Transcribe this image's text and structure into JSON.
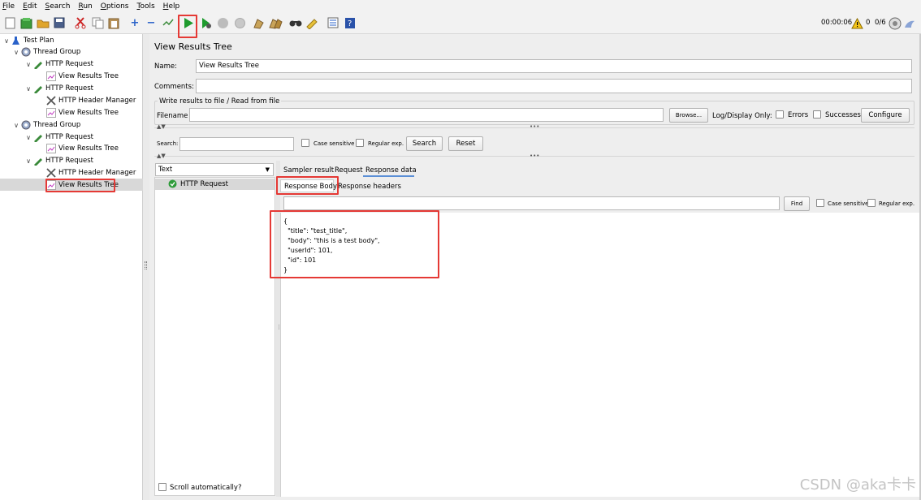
{
  "menu": [
    "File",
    "Edit",
    "Search",
    "Run",
    "Options",
    "Tools",
    "Help"
  ],
  "toolbar": {
    "icons": [
      "new-icon",
      "templates-icon",
      "open-icon",
      "save-icon",
      "cut-icon",
      "copy-icon",
      "paste-icon",
      "expand-icon",
      "collapse-icon",
      "toggle-icon",
      "start-icon",
      "start-no-pauses-icon",
      "stop-icon",
      "shutdown-icon",
      "clear-icon",
      "clear-all-icon",
      "search-icon",
      "reset-search-icon",
      "function-helper-icon",
      "help-icon"
    ],
    "timer": "00:00:06",
    "warnings": "0",
    "threads": "0/6"
  },
  "tree": [
    {
      "label": "Test Plan",
      "icon": "flask-icon"
    },
    {
      "label": "Thread Group",
      "icon": "gear-icon"
    },
    {
      "label": "HTTP Request",
      "icon": "pipette-icon"
    },
    {
      "label": "View Results Tree",
      "icon": "chart-icon"
    },
    {
      "label": "HTTP Request",
      "icon": "pipette-icon"
    },
    {
      "label": "HTTP Header Manager",
      "icon": "wrench-icon"
    },
    {
      "label": "View Results Tree",
      "icon": "chart-icon"
    },
    {
      "label": "Thread Group",
      "icon": "gear-icon"
    },
    {
      "label": "HTTP Request",
      "icon": "pipette-icon"
    },
    {
      "label": "View Results Tree",
      "icon": "chart-icon"
    },
    {
      "label": "HTTP Request",
      "icon": "pipette-icon"
    },
    {
      "label": "HTTP Header Manager",
      "icon": "wrench-icon"
    },
    {
      "label": "View Results Tree",
      "icon": "chart-icon"
    }
  ],
  "panel": {
    "title": "View Results Tree",
    "name_label": "Name:",
    "name_value": "View Results Tree",
    "comments_label": "Comments:",
    "comments_value": "",
    "file_section": "Write results to file / Read from file",
    "filename_label": "Filename",
    "filename_value": "",
    "browse": "Browse...",
    "log_display": "Log/Display Only:",
    "errors": "Errors",
    "successes": "Successes",
    "configure": "Configure",
    "search_label": "Search:",
    "search_value": "",
    "case_sensitive": "Case sensitive",
    "regular_exp": "Regular exp.",
    "search_btn": "Search",
    "reset_btn": "Reset",
    "renderer": "Text",
    "result_item": "HTTP Request",
    "tabs": [
      "Sampler result",
      "Request",
      "Response data"
    ],
    "subtabs": [
      "Response Body",
      "Response headers"
    ],
    "find_value": "",
    "find_btn": "Find",
    "find_case": "Case sensitive",
    "find_regex": "Regular exp.",
    "scroll_auto": "Scroll automatically?"
  },
  "response_body": [
    "{",
    "  \"title\": \"test_title\",",
    "  \"body\": \"this is a test body\",",
    "  \"userId\": 101,",
    "  \"id\": 101",
    "}"
  ],
  "watermark": "CSDN @aka卡卡",
  "colors": {
    "highlight": "#e53935",
    "selected_row": "#d8d8d8",
    "tab_underline": "#5b8fd6"
  }
}
